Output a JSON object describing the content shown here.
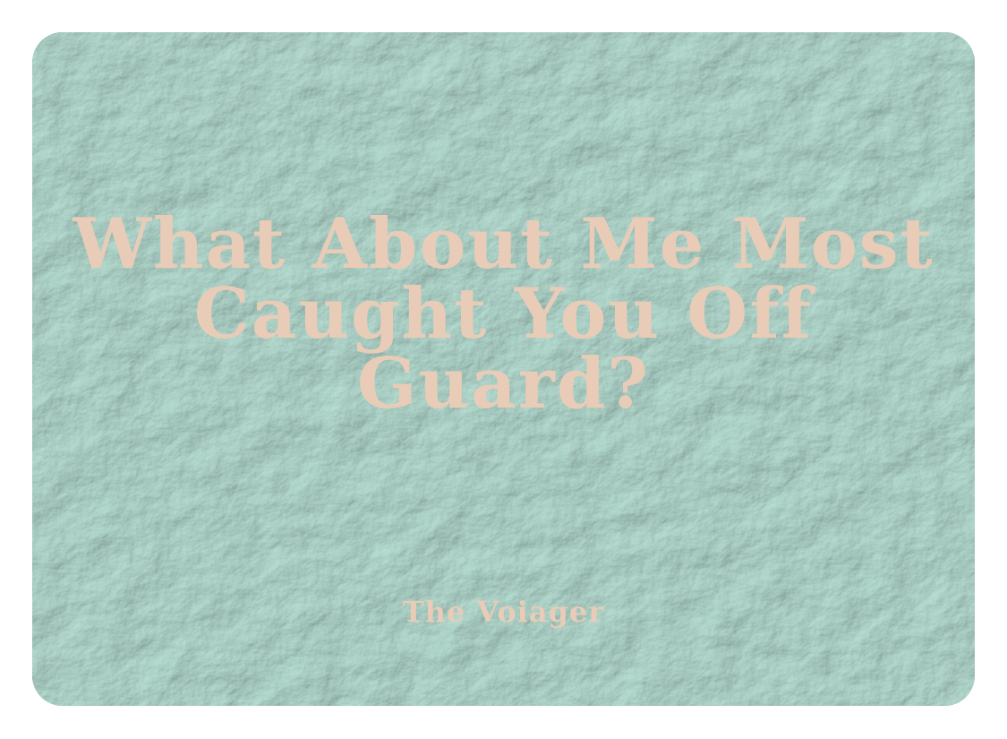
{
  "card": {
    "title": "What About Me Most Caught You Off Guard?",
    "byline": "The Voiager"
  },
  "colors": {
    "background": "#6da596",
    "text": "#e8ccb7",
    "page": "#ffffff"
  }
}
